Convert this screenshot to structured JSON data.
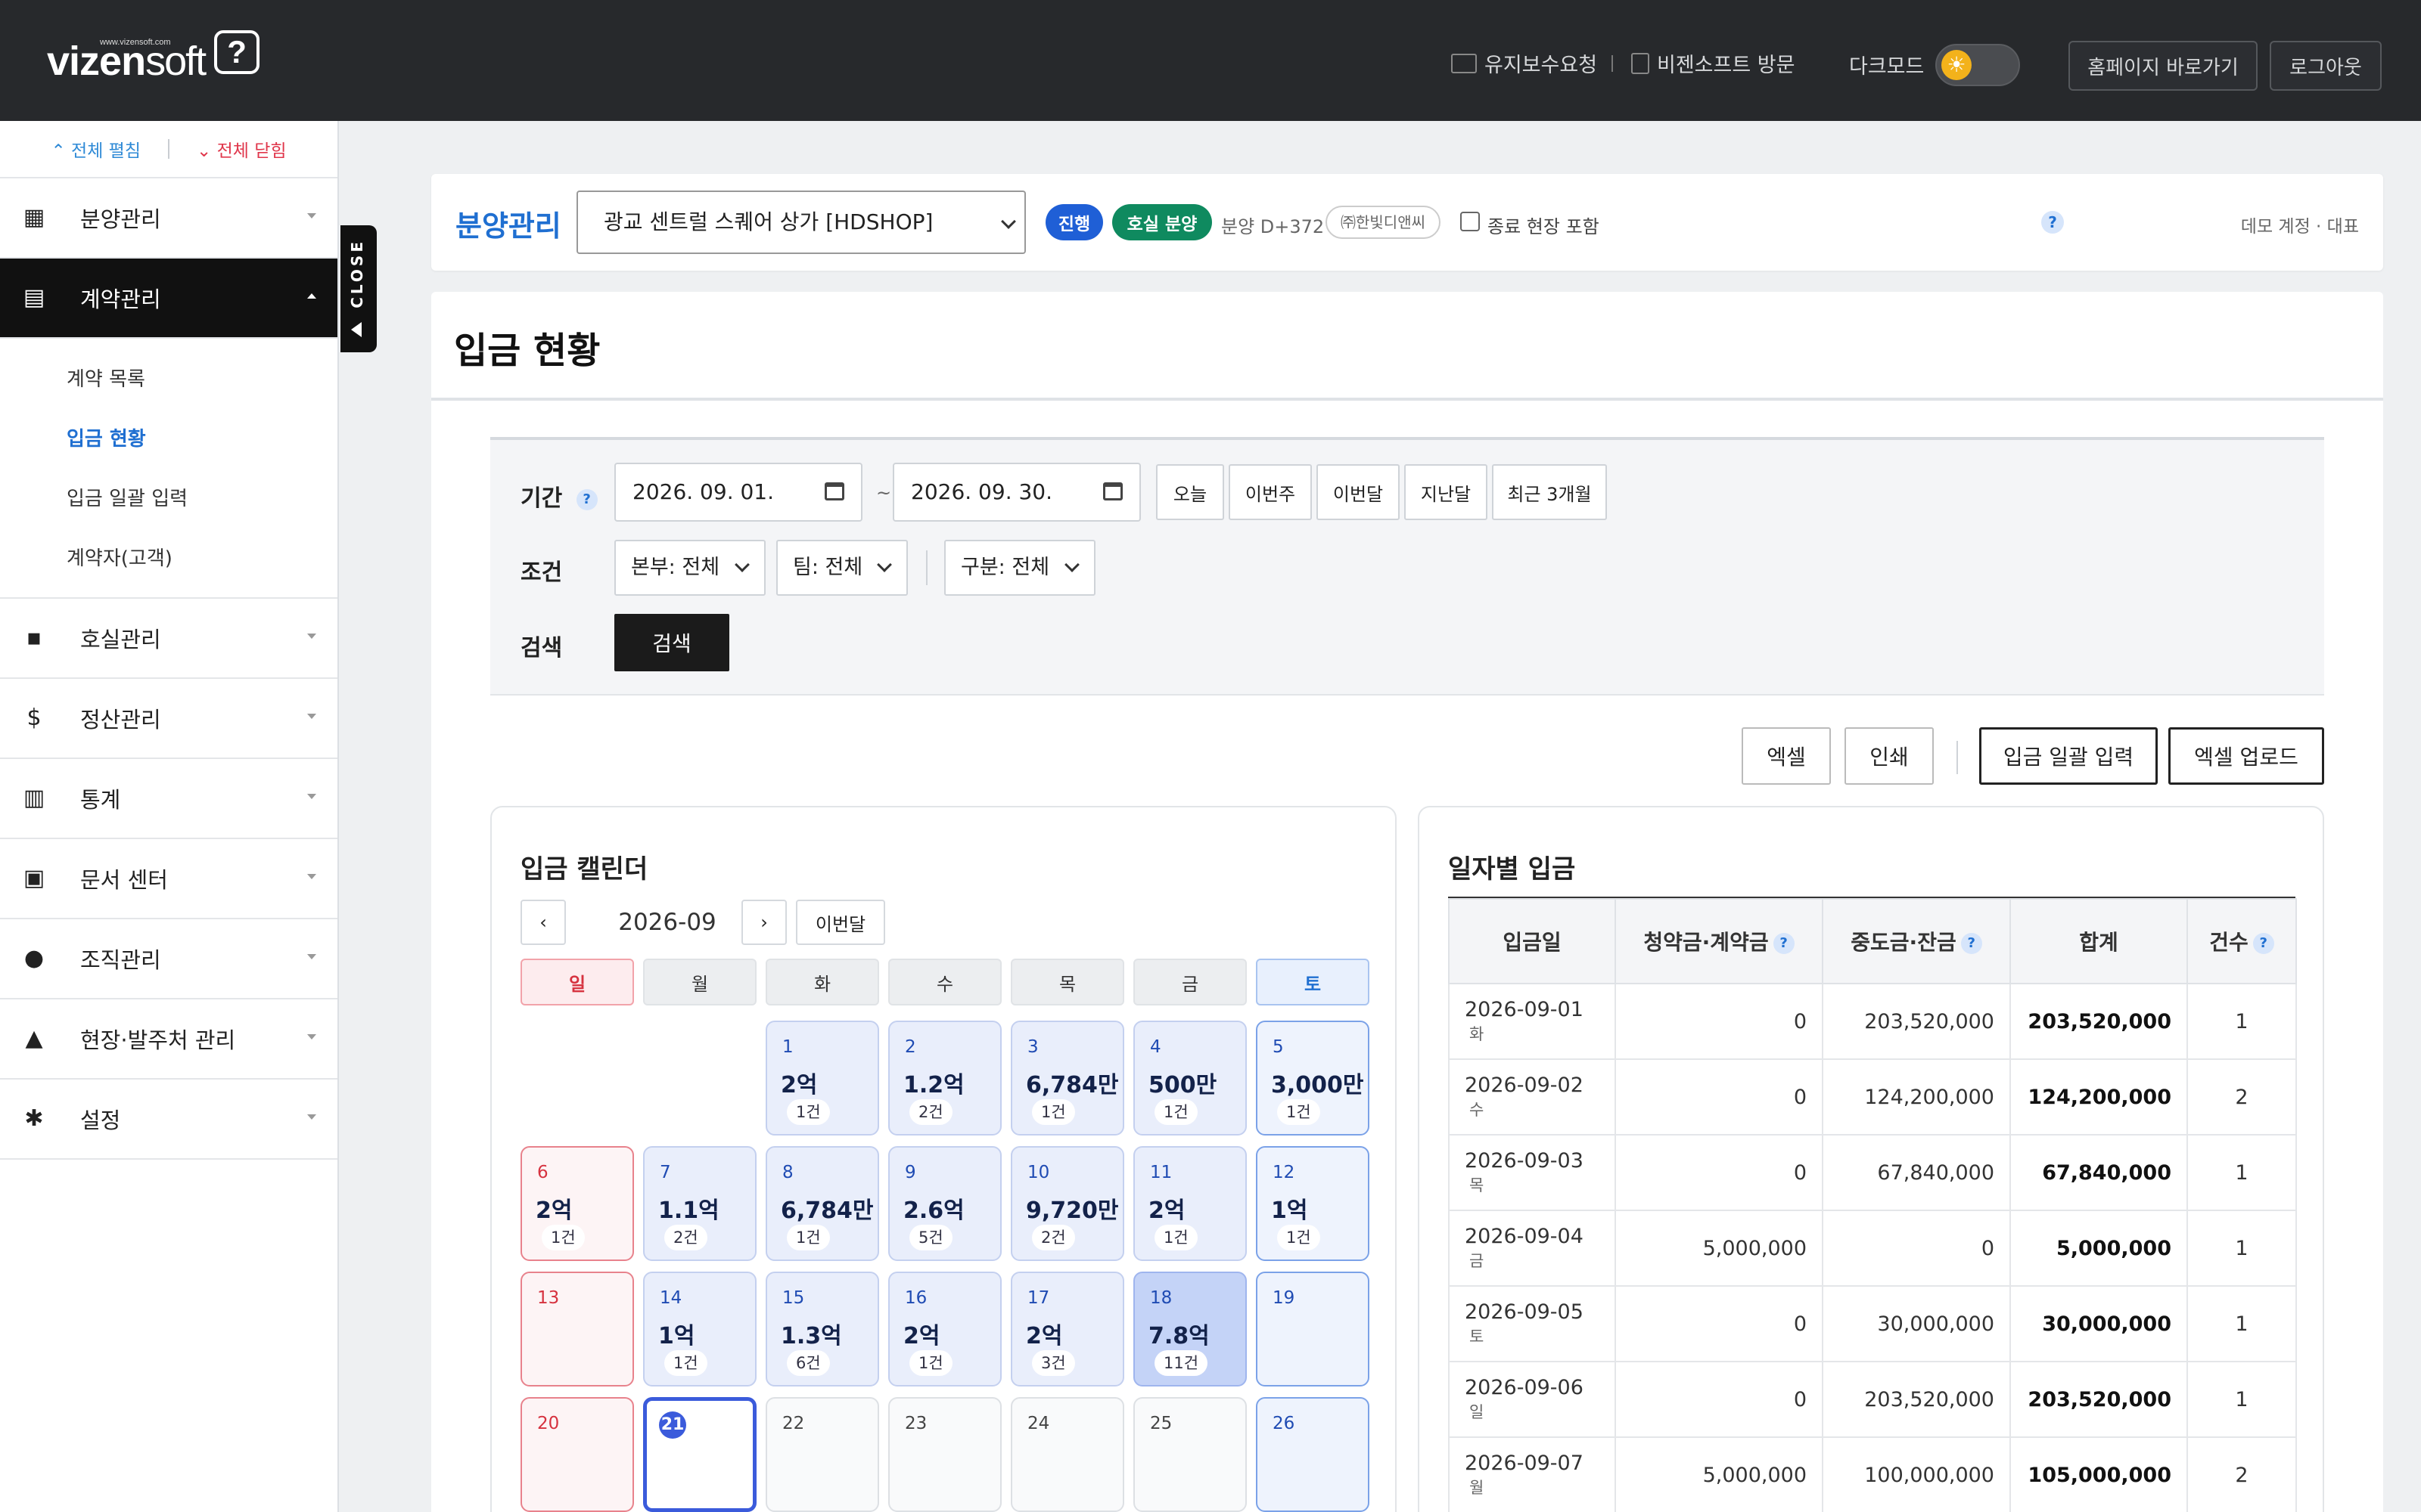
{
  "header": {
    "logo_url_text": "www.vizensoft.com",
    "logo_vizen": "vizen",
    "logo_soft": "soft",
    "logo_q": "?",
    "maintenance_link": "유지보수요청",
    "visit_link": "비젠소프트 방문",
    "darkmode_label": "다크모드",
    "homepage_button": "홈페이지 바로가기",
    "logout_button": "로그아웃",
    "toggle_icon": "☀"
  },
  "sidebar": {
    "expand_all": "⌃ 전체 펼침",
    "collapse_all": "⌄ 전체 닫힘",
    "menu": [
      {
        "label": "분양관리",
        "icon": "building-icon"
      },
      {
        "label": "계약관리",
        "icon": "document-icon"
      },
      {
        "label": "호실관리",
        "icon": "grid-icon"
      },
      {
        "label": "정산관리",
        "icon": "dollar-icon"
      },
      {
        "label": "통계",
        "icon": "chart-icon"
      },
      {
        "label": "문서 센터",
        "icon": "pdf-icon"
      },
      {
        "label": "조직관리",
        "icon": "people-icon"
      },
      {
        "label": "현장·발주처 관리",
        "icon": "bank-icon"
      },
      {
        "label": "설정",
        "icon": "gear-icon"
      }
    ],
    "submenu": [
      "계약 목록",
      "입금 현황",
      "입금 일괄 입력",
      "계약자(고객)"
    ],
    "close_tab": "CLOSE"
  },
  "project": {
    "title": "분양관리",
    "selected_site": "광교 센트럴 스퀘어 상가 [HDSHOP]",
    "status_pill": "진행",
    "type_pill": "호실 분양",
    "dday": "분양 D+372",
    "company": "㈜한빛디앤씨",
    "include_closed_label": "종료 현장 포함",
    "help": "?",
    "user": "데모 계정 · 대표",
    "colors": {
      "status": "#1f5fd6",
      "type": "#0f8a5f"
    }
  },
  "page": {
    "title": "입금 현황"
  },
  "filter": {
    "period_label": "기간",
    "condition_label": "조건",
    "search_label": "검색",
    "date_from": "2026. 09. 01.",
    "date_to": "2026. 09. 30.",
    "tilde": "~",
    "quick": [
      "오늘",
      "이번주",
      "이번달",
      "지난달",
      "최근 3개월"
    ],
    "dropdowns": [
      "본부: 전체",
      "팀: 전체",
      "구분: 전체"
    ],
    "search_button": "검색"
  },
  "actions": {
    "excel": "엑셀",
    "print": "인쇄",
    "bulk_input": "입금 일괄 입력",
    "excel_upload": "엑셀 업로드"
  },
  "calendar": {
    "title": "입금 캘린더",
    "month": "2026-09",
    "prev": "‹",
    "next": "›",
    "this_month": "이번달",
    "weekdays": [
      "일",
      "월",
      "화",
      "수",
      "목",
      "금",
      "토"
    ],
    "days": [
      {
        "d": "1",
        "amt": "2억",
        "cnt": "1건"
      },
      {
        "d": "2",
        "amt": "1.2억",
        "cnt": "2건"
      },
      {
        "d": "3",
        "amt": "6,784만",
        "cnt": "1건"
      },
      {
        "d": "4",
        "amt": "500만",
        "cnt": "1건"
      },
      {
        "d": "5",
        "amt": "3,000만",
        "cnt": "1건"
      },
      {
        "d": "6",
        "amt": "2억",
        "cnt": "1건"
      },
      {
        "d": "7",
        "amt": "1.1억",
        "cnt": "2건"
      },
      {
        "d": "8",
        "amt": "6,784만",
        "cnt": "1건"
      },
      {
        "d": "9",
        "amt": "2.6억",
        "cnt": "5건"
      },
      {
        "d": "10",
        "amt": "9,720만",
        "cnt": "2건"
      },
      {
        "d": "11",
        "amt": "2억",
        "cnt": "1건"
      },
      {
        "d": "12",
        "amt": "1억",
        "cnt": "1건"
      },
      {
        "d": "13",
        "amt": "",
        "cnt": ""
      },
      {
        "d": "14",
        "amt": "1억",
        "cnt": "1건"
      },
      {
        "d": "15",
        "amt": "1.3억",
        "cnt": "6건"
      },
      {
        "d": "16",
        "amt": "2억",
        "cnt": "1건"
      },
      {
        "d": "17",
        "amt": "2억",
        "cnt": "3건"
      },
      {
        "d": "18",
        "amt": "7.8억",
        "cnt": "11건"
      },
      {
        "d": "19",
        "amt": "",
        "cnt": ""
      },
      {
        "d": "20",
        "amt": "",
        "cnt": ""
      },
      {
        "d": "21",
        "amt": "",
        "cnt": ""
      },
      {
        "d": "22",
        "amt": "",
        "cnt": ""
      },
      {
        "d": "23",
        "amt": "",
        "cnt": ""
      },
      {
        "d": "24",
        "amt": "",
        "cnt": ""
      },
      {
        "d": "25",
        "amt": "",
        "cnt": ""
      },
      {
        "d": "26",
        "amt": "",
        "cnt": ""
      }
    ]
  },
  "daily": {
    "title": "일자별 입금",
    "columns": [
      "입금일",
      "청약금·계약금",
      "중도금·잔금",
      "합계",
      "건수"
    ],
    "rows": [
      {
        "date": "2026-09-01",
        "wd": "화",
        "deposit": "0",
        "balance": "203,520,000",
        "sum": "203,520,000",
        "count": "1"
      },
      {
        "date": "2026-09-02",
        "wd": "수",
        "deposit": "0",
        "balance": "124,200,000",
        "sum": "124,200,000",
        "count": "2"
      },
      {
        "date": "2026-09-03",
        "wd": "목",
        "deposit": "0",
        "balance": "67,840,000",
        "sum": "67,840,000",
        "count": "1"
      },
      {
        "date": "2026-09-04",
        "wd": "금",
        "deposit": "5,000,000",
        "balance": "0",
        "sum": "5,000,000",
        "count": "1"
      },
      {
        "date": "2026-09-05",
        "wd": "토",
        "deposit": "0",
        "balance": "30,000,000",
        "sum": "30,000,000",
        "count": "1"
      },
      {
        "date": "2026-09-06",
        "wd": "일",
        "deposit": "0",
        "balance": "203,520,000",
        "sum": "203,520,000",
        "count": "1"
      },
      {
        "date": "2026-09-07",
        "wd": "월",
        "deposit": "5,000,000",
        "balance": "100,000,000",
        "sum": "105,000,000",
        "count": "2"
      }
    ]
  }
}
